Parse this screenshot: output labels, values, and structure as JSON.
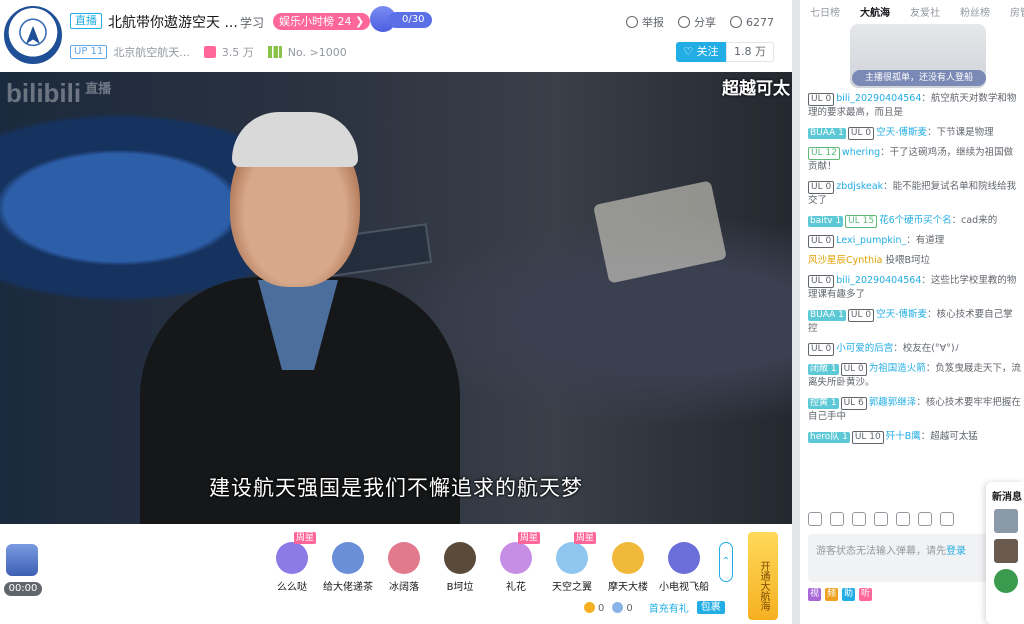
{
  "header": {
    "live_tag": "直播",
    "title": "北航带你遨游空天 ...",
    "area": "学习",
    "rank_badge": "娱乐小时榜 24 ❯",
    "fans_club_count": "0/30",
    "report": "举报",
    "share": "分享",
    "viewers": "6277",
    "ul_level": "UP 11",
    "streamer_name": "北京航空航天...",
    "gift_count": "3.5 万",
    "rank_no": "No. >1000",
    "follow_label": "♡ 关注",
    "follower_count": "1.8 万"
  },
  "video": {
    "watermark": "bilibili",
    "watermark_sub": "直播",
    "corner_text": "超越可太",
    "subtitle": "建设航天强国是我们不懈追求的航天梦"
  },
  "giftbar": {
    "timer": "00:00",
    "gifts": [
      {
        "label": "么么哒",
        "week": "周星",
        "color": "#8c7ae6"
      },
      {
        "label": "给大佬递茶",
        "week": "",
        "color": "#6a8fd8"
      },
      {
        "label": "冰阔落",
        "week": "",
        "color": "#e07a8c"
      },
      {
        "label": "B坷垃",
        "week": "",
        "color": "#5a4a3a"
      },
      {
        "label": "礼花",
        "week": "周星",
        "color": "#c78ee6"
      },
      {
        "label": "天空之翼",
        "week": "周星",
        "color": "#8fc6ef"
      },
      {
        "label": "摩天大楼",
        "week": "",
        "color": "#f0b93a"
      },
      {
        "label": "小电视飞船",
        "week": "",
        "color": "#6c6fd9"
      }
    ],
    "guard_label": "开通大航海",
    "gold": "0",
    "silver": "0",
    "charge": "首充有礼",
    "pack": "包裹"
  },
  "right": {
    "tabs": [
      "七日榜",
      "大航海",
      "友爱社",
      "粉丝榜",
      "房管"
    ],
    "rank_empty": "主播很孤单，还没有人登船",
    "messages": [
      {
        "fan": "",
        "fan_color": "",
        "lv": "UL 0",
        "lv_green": false,
        "user": "bili_20290404564",
        "text": "：航空航天对数学和物理的要求最高，而且是",
        "gold": false
      },
      {
        "fan": "BUAA",
        "fan_lv": "1",
        "fan_color": "#5ec9d6",
        "lv": "UL 0",
        "lv_green": false,
        "user": "空天-傅斯麦",
        "text": "：下节课是物理",
        "gold": false
      },
      {
        "fan": "",
        "fan_color": "",
        "lv": "UL 12",
        "lv_green": true,
        "user": "whering",
        "text": "：干了这碗鸡汤，继续为祖国做贡献！",
        "gold": false
      },
      {
        "fan": "",
        "fan_color": "",
        "lv": "UL 0",
        "lv_green": false,
        "user": "zbdjskeak",
        "text": "：能不能把复试名单和院线给我交了",
        "gold": false
      },
      {
        "fan": "baitv",
        "fan_lv": "1",
        "fan_color": "#5ec9d6",
        "lv": "UL 15",
        "lv_green": true,
        "user": "花6个硬币买个名",
        "text": "：cad来的",
        "gold": false
      },
      {
        "fan": "",
        "fan_color": "",
        "lv": "UL 0",
        "lv_green": false,
        "user": "Lexi_pumpkin_",
        "text": "：有道理",
        "gold": false
      },
      {
        "fan": "",
        "fan_color": "",
        "lv": "",
        "lv_green": false,
        "user": "风沙星辰Cynthia",
        "text": " 投喂B坷垃",
        "gold": true
      },
      {
        "fan": "",
        "fan_color": "",
        "lv": "UL 0",
        "lv_green": false,
        "user": "bili_20290404564",
        "text": "：这些比学校里教的物理课有趣多了",
        "gold": false
      },
      {
        "fan": "BUAA",
        "fan_lv": "1",
        "fan_color": "#5ec9d6",
        "lv": "UL 0",
        "lv_green": false,
        "user": "空天-傅斯麦",
        "text": "：核心技术要自己掌控",
        "gold": false
      },
      {
        "fan": "",
        "fan_color": "",
        "lv": "UL 0",
        "lv_green": false,
        "user": "小可爱的后宫",
        "text": "：校友在(°∀°)ﾉ",
        "gold": false
      },
      {
        "fan": "闭敞",
        "fan_lv": "1",
        "fan_color": "#5ec9d6",
        "lv": "UL 0",
        "lv_green": false,
        "user": "为祖国造火箭",
        "text": "：负笈曳屐走天下，流离失所卧黄沙。",
        "gold": false
      },
      {
        "fan": "控黄",
        "fan_lv": "1",
        "fan_color": "#5ec9d6",
        "lv": "UL 6",
        "lv_green": false,
        "user": "郭趣郭继泽",
        "text": "：核心技术要牢牢把握在自己手中",
        "gold": false
      },
      {
        "fan": "hero队",
        "fan_lv": "1",
        "fan_color": "#5ec9d6",
        "lv": "UL 10",
        "lv_green": false,
        "user": "歼十B鹰",
        "text": "：超越可太猛",
        "gold": false
      }
    ],
    "input_placeholder": "游客状态无法输入弹幕，请先",
    "input_login": "登录",
    "bottom_tags": [
      "视",
      "频",
      "助",
      "听"
    ],
    "popup_title": "新消息"
  }
}
